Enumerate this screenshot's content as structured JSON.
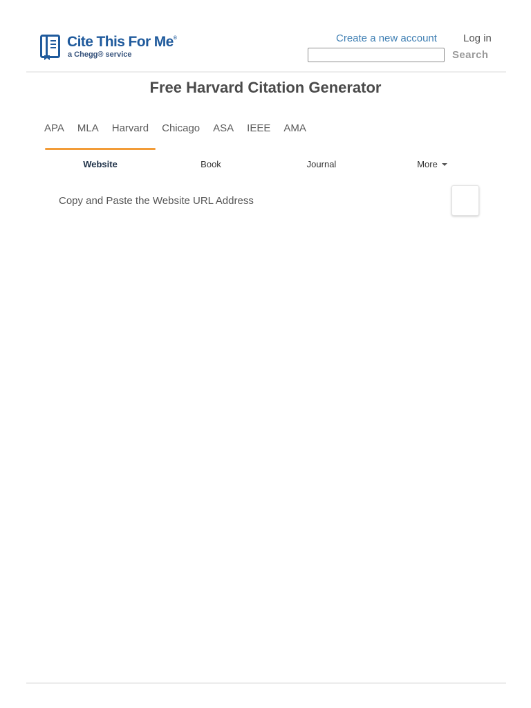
{
  "header": {
    "logo": {
      "title": "Cite This For Me",
      "title_mark": "®",
      "subtitle": "a Chegg® service"
    },
    "create_account_label": "Create a new account",
    "login_label": "Log in",
    "search": {
      "value": "",
      "button_label": "Search"
    }
  },
  "main": {
    "title": "Free Harvard Citation Generator",
    "style_tabs": [
      "APA",
      "MLA",
      "Harvard",
      "Chicago",
      "ASA",
      "IEEE",
      "AMA"
    ],
    "source_tabs": [
      {
        "label": "Website",
        "active": true
      },
      {
        "label": "Book",
        "active": false
      },
      {
        "label": "Journal",
        "active": false
      },
      {
        "label": "More",
        "active": false
      }
    ],
    "url_input": {
      "placeholder": "Copy and Paste the Website URL Address",
      "value": ""
    }
  },
  "colors": {
    "brand_blue": "#1f5a9c",
    "link_blue": "#3f7fb3",
    "active_tab_accent": "#f29c38"
  },
  "icons": {
    "logo": "book-bookmark-icon",
    "more_dropdown": "caret-down-icon"
  }
}
